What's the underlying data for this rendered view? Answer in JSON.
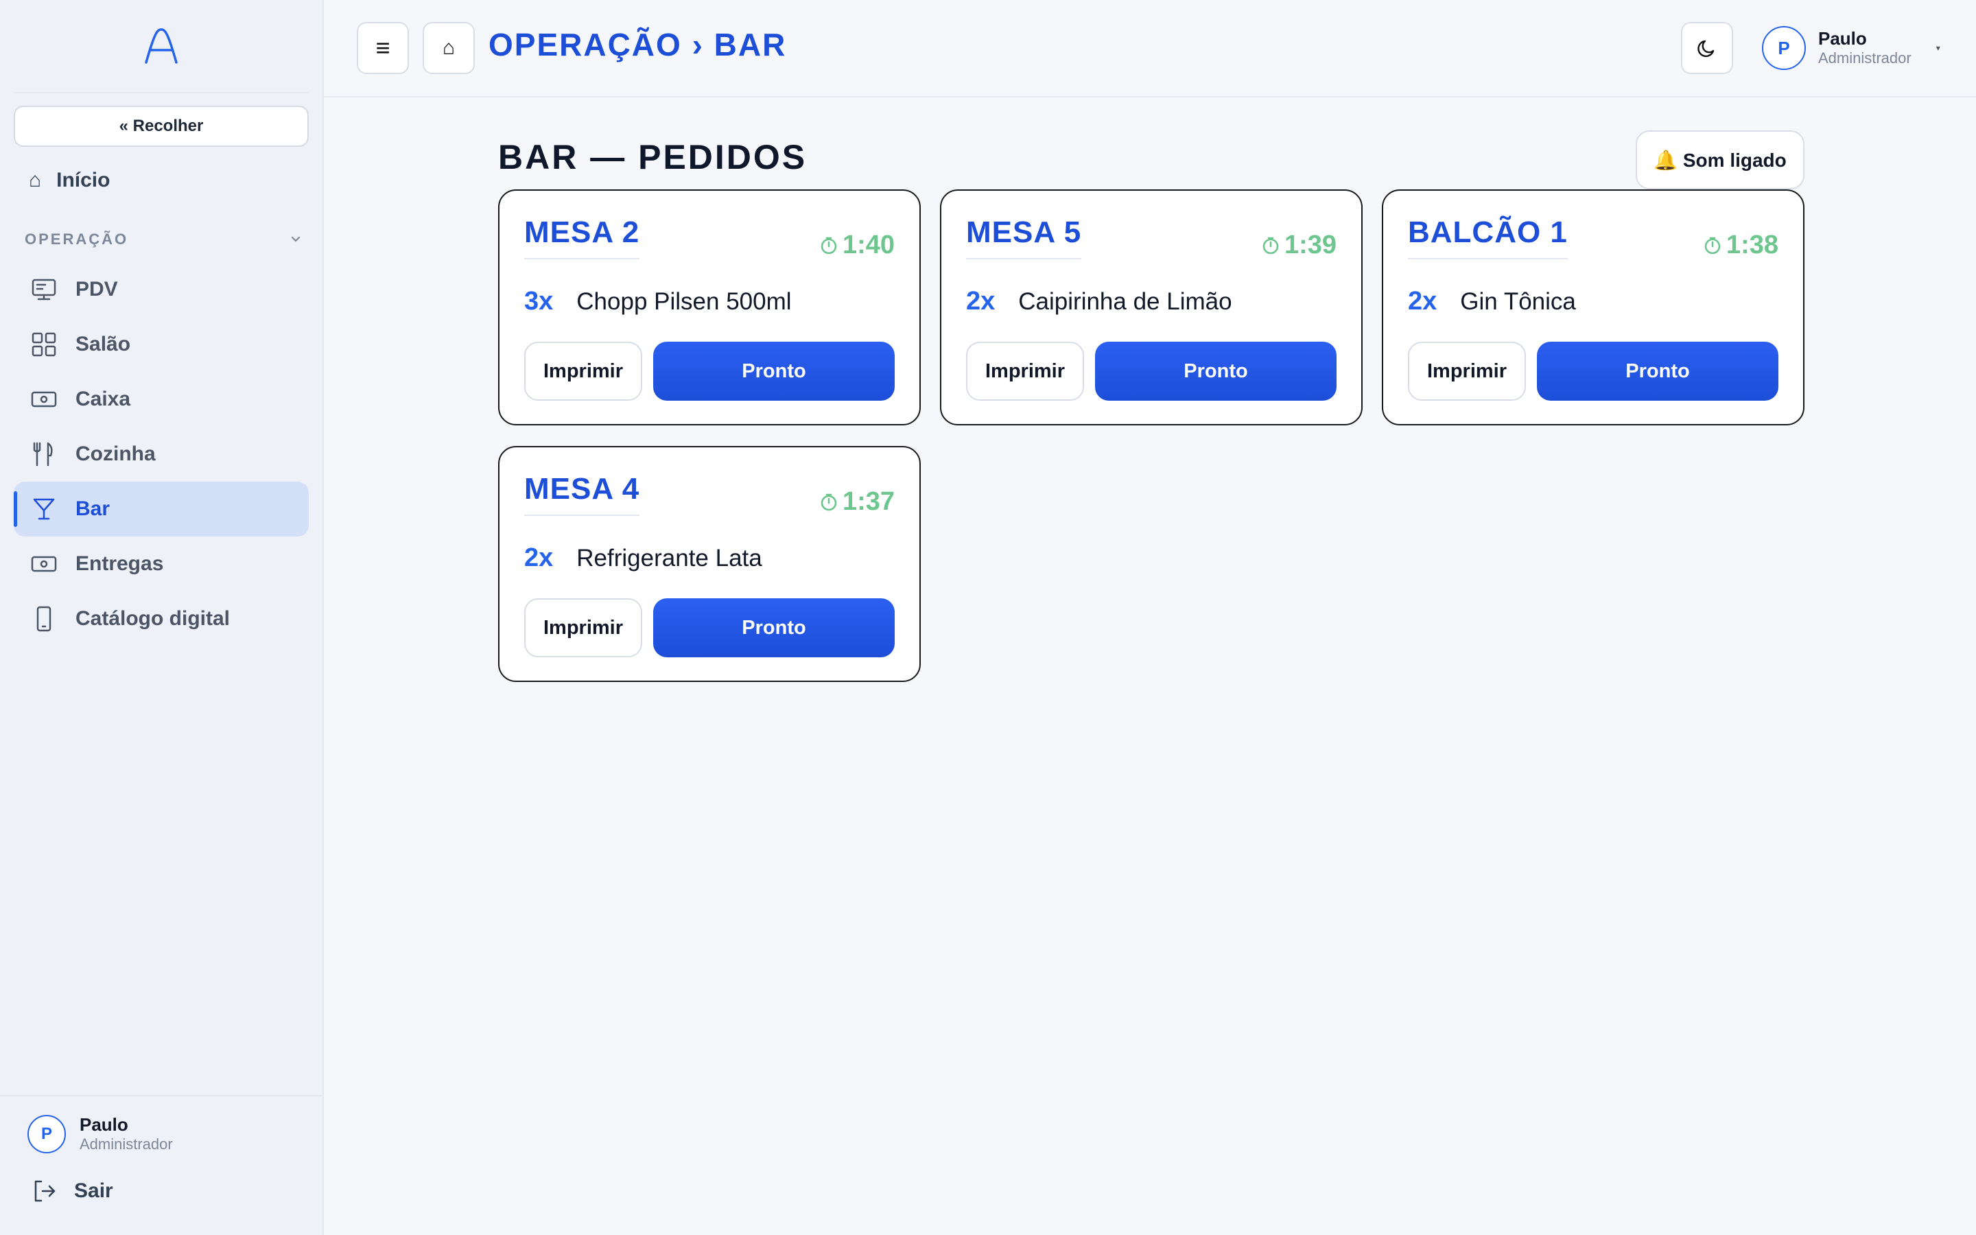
{
  "sidebar": {
    "collapse_label": "« Recolher",
    "home_label": "Início",
    "section_label": "OPERAÇÃO",
    "items": [
      {
        "label": "PDV",
        "icon": "monitor-icon"
      },
      {
        "label": "Salão",
        "icon": "grid-icon"
      },
      {
        "label": "Caixa",
        "icon": "cash-icon"
      },
      {
        "label": "Cozinha",
        "icon": "utensils-icon"
      },
      {
        "label": "Bar",
        "icon": "cocktail-icon",
        "active": true
      },
      {
        "label": "Entregas",
        "icon": "cash-icon"
      },
      {
        "label": "Catálogo digital",
        "icon": "phone-icon"
      }
    ],
    "user": {
      "initial": "P",
      "name": "Paulo",
      "role": "Administrador"
    },
    "logout_label": "Sair"
  },
  "header": {
    "menu_icon": "≡",
    "home_icon": "⌂",
    "breadcrumb": "OPERAÇÃO › BAR",
    "user": {
      "initial": "P",
      "name": "Paulo",
      "role": "Administrador"
    }
  },
  "page": {
    "title": "BAR — PEDIDOS",
    "sound_label": "🔔 Som ligado",
    "print_label": "Imprimir",
    "ready_label": "Pronto",
    "orders": [
      {
        "title": "MESA 2",
        "timer": "1:40",
        "qty": "3x",
        "item": "Chopp Pilsen 500ml"
      },
      {
        "title": "MESA 5",
        "timer": "1:39",
        "qty": "2x",
        "item": "Caipirinha de Limão"
      },
      {
        "title": "BALCÃO 1",
        "timer": "1:38",
        "qty": "2x",
        "item": "Gin Tônica"
      },
      {
        "title": "MESA 4",
        "timer": "1:37",
        "qty": "2x",
        "item": "Refrigerante Lata"
      }
    ]
  },
  "colors": {
    "accent": "#1d4ed8",
    "timer": "#6cc68e",
    "active_bg": "#d4e0f8"
  }
}
